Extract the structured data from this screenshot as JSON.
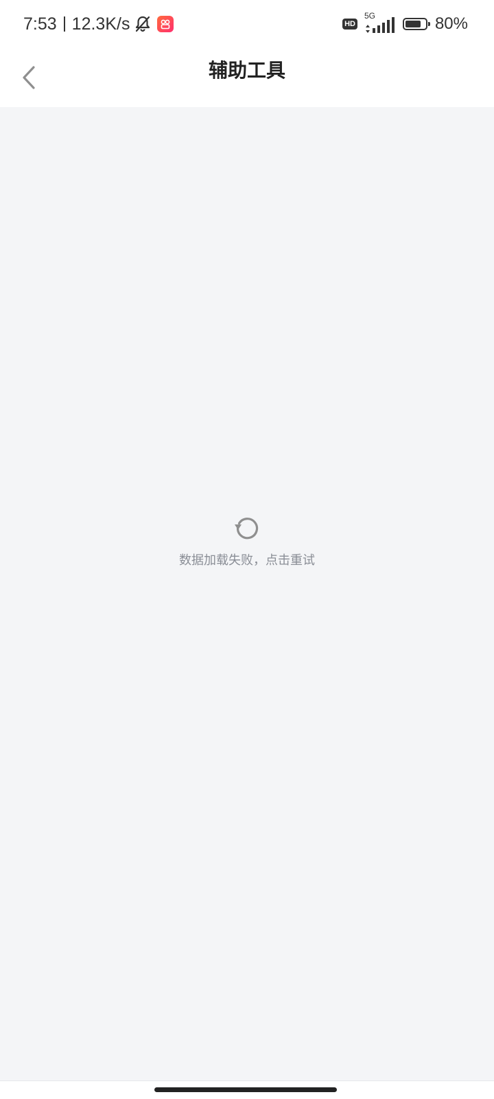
{
  "status_bar": {
    "time": "7:53",
    "net_speed": "12.3K/s",
    "network_badge": "HD",
    "network_type": "5G",
    "battery_percent": "80%",
    "battery_level": 0.8,
    "icons": [
      "bell-muted-icon",
      "app-notification-icon",
      "hd-icon",
      "signal-icon",
      "battery-icon"
    ]
  },
  "header": {
    "title": "辅助工具",
    "back_icon": "chevron-left-icon"
  },
  "content": {
    "retry_icon": "refresh-icon",
    "error_text": "数据加载失败，点击重试"
  },
  "colors": {
    "background": "#f4f5f7",
    "header_bg": "#ffffff",
    "error_text": "#8a8e96",
    "icon_gray": "#8f8f8f"
  }
}
